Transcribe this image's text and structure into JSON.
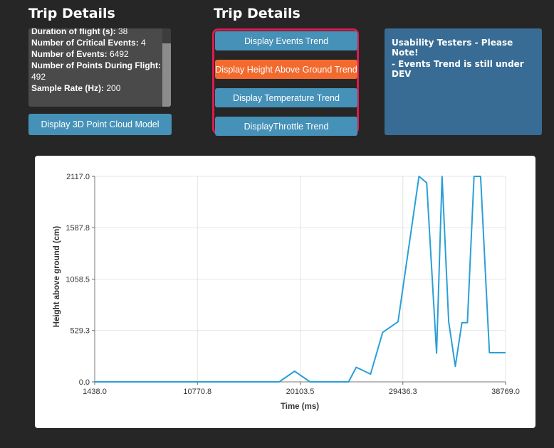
{
  "left_panel": {
    "title": "Trip Details",
    "stats": [
      {
        "label": "Duration of flight (s):",
        "value": "38"
      },
      {
        "label": "Number of Critical Events:",
        "value": "4"
      },
      {
        "label": "Number of Events:",
        "value": "6492"
      },
      {
        "label": "Number of Points During Flight:",
        "value": "492"
      },
      {
        "label": "Sample Rate (Hz):",
        "value": "200"
      }
    ],
    "pointcloud_button": "Display 3D Point Cloud Model"
  },
  "right_panel": {
    "title": "Trip Details",
    "buttons": [
      {
        "label": "Display Events Trend",
        "active": false
      },
      {
        "label": "Display Height Above Ground Trend",
        "active": true
      },
      {
        "label": "Display Temperature Trend",
        "active": false
      },
      {
        "label": "DisplayThrottle Trend",
        "active": false
      }
    ],
    "active_color": "#f26a2e",
    "button_color": "#4691b7",
    "group_border_color": "#e0194f"
  },
  "notice": {
    "line1": "Usability Testers - Please Note!",
    "line2": "- Events Trend is still under DEV",
    "background": "#386c94"
  },
  "chart_data": {
    "type": "line",
    "xlabel": "Time (ms)",
    "ylabel": "Height above ground (cm)",
    "x_ticks": [
      "1438.0",
      "10770.8",
      "20103.5",
      "29436.3",
      "38769.0"
    ],
    "y_ticks": [
      "0.0",
      "529.3",
      "1058.5",
      "1587.8",
      "2117.0"
    ],
    "xlim": [
      1438.0,
      38769.0
    ],
    "ylim": [
      0,
      2117.0
    ],
    "grid": true,
    "line_color": "#2a9fd6",
    "series": [
      {
        "x": [
          1438,
          3000,
          6000,
          9000,
          12000,
          15000,
          17000,
          18200,
          19600,
          21000,
          23000,
          24500,
          25200,
          26500,
          27600,
          29000,
          30900,
          31600,
          32500,
          33000,
          33600,
          34200,
          34800,
          35300,
          35900,
          36500,
          37300,
          38000,
          38769
        ],
        "y": [
          0,
          0,
          0,
          0,
          0,
          0,
          0,
          0,
          110,
          0,
          0,
          0,
          150,
          80,
          510,
          620,
          2117,
          2050,
          295,
          2117,
          620,
          160,
          610,
          610,
          2117,
          2117,
          300,
          300,
          300
        ]
      }
    ]
  }
}
